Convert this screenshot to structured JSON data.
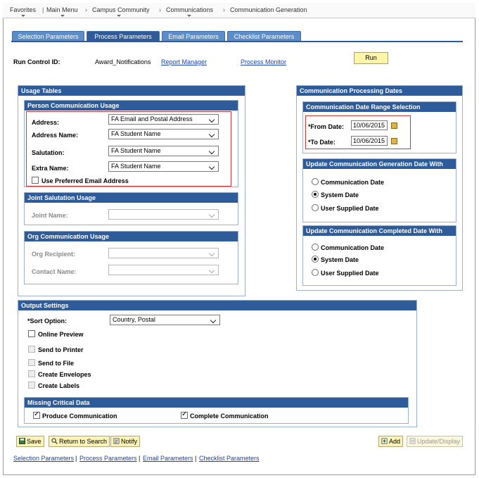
{
  "breadcrumb": [
    "Favorites",
    "Main Menu",
    "Campus Community",
    "Communications",
    "Communication Generation"
  ],
  "tabs": [
    "Selection Parameters",
    "Process Parameters",
    "Email Parameters",
    "Checklist Parameters"
  ],
  "active_tab": "Process Parameters",
  "run_control": {
    "label": "Run Control ID:",
    "value": "Award_Notifications",
    "report_manager": "Report Manager",
    "process_monitor": "Process Monitor",
    "run_button": "Run"
  },
  "usage_tables": {
    "title": "Usage Tables",
    "person": {
      "title": "Person Communication Usage",
      "address_label": "Address:",
      "address_value": "FA Email and Postal Address",
      "address_name_label": "Address Name:",
      "address_name_value": "FA Student Name",
      "salutation_label": "Salutation:",
      "salutation_value": "FA Student Name",
      "extra_name_label": "Extra Name:",
      "extra_name_value": "FA Student Name",
      "preferred_email_label": "Use Preferred Email Address",
      "preferred_email_checked": false
    },
    "joint": {
      "title": "Joint Salutation Usage",
      "joint_name_label": "Joint Name:"
    },
    "org": {
      "title": "Org Communication Usage",
      "recipient_label": "Org Recipient:",
      "contact_label": "Contact Name:"
    }
  },
  "processing_dates": {
    "title": "Communication Processing Dates",
    "range": {
      "title": "Communication Date Range Selection",
      "from_label": "*From Date:",
      "from_value": "10/06/2015",
      "to_label": "*To Date:",
      "to_value": "10/06/2015"
    },
    "generation": {
      "title": "Update Communication Generation Date With",
      "options": [
        "Communication Date",
        "System Date",
        "User Supplied Date"
      ],
      "selected": "System Date"
    },
    "completed": {
      "title": "Update Communication Completed Date With",
      "options": [
        "Communication Date",
        "System Date",
        "User Supplied Date"
      ],
      "selected": "System Date"
    }
  },
  "output": {
    "title": "Output Settings",
    "sort_label": "*Sort Option:",
    "sort_value": "Country, Postal",
    "online_preview": "Online Preview",
    "send_to_printer": "Send to Printer",
    "send_to_file": "Send to File",
    "create_envelopes": "Create Envelopes",
    "create_labels": "Create Labels",
    "missing": {
      "title": "Missing Critical Data",
      "produce_label": "Produce Communication",
      "produce_checked": true,
      "complete_label": "Complete Communication",
      "complete_checked": true
    }
  },
  "buttons": {
    "save": "Save",
    "return_to_search": "Return to Search",
    "notify": "Notify",
    "add": "Add",
    "update_display": "Update/Display"
  },
  "footer_links": [
    "Selection Parameters",
    "Process Parameters",
    "Email Parameters",
    "Checklist Parameters"
  ],
  "footer_sep": "|",
  "colors": {
    "header_blue": "#2e5b9a",
    "tab_blue": "#5b8ec8",
    "link": "#1a43a8",
    "highlight_red": "#d33434",
    "button_yellow": "#fbf3b8"
  }
}
